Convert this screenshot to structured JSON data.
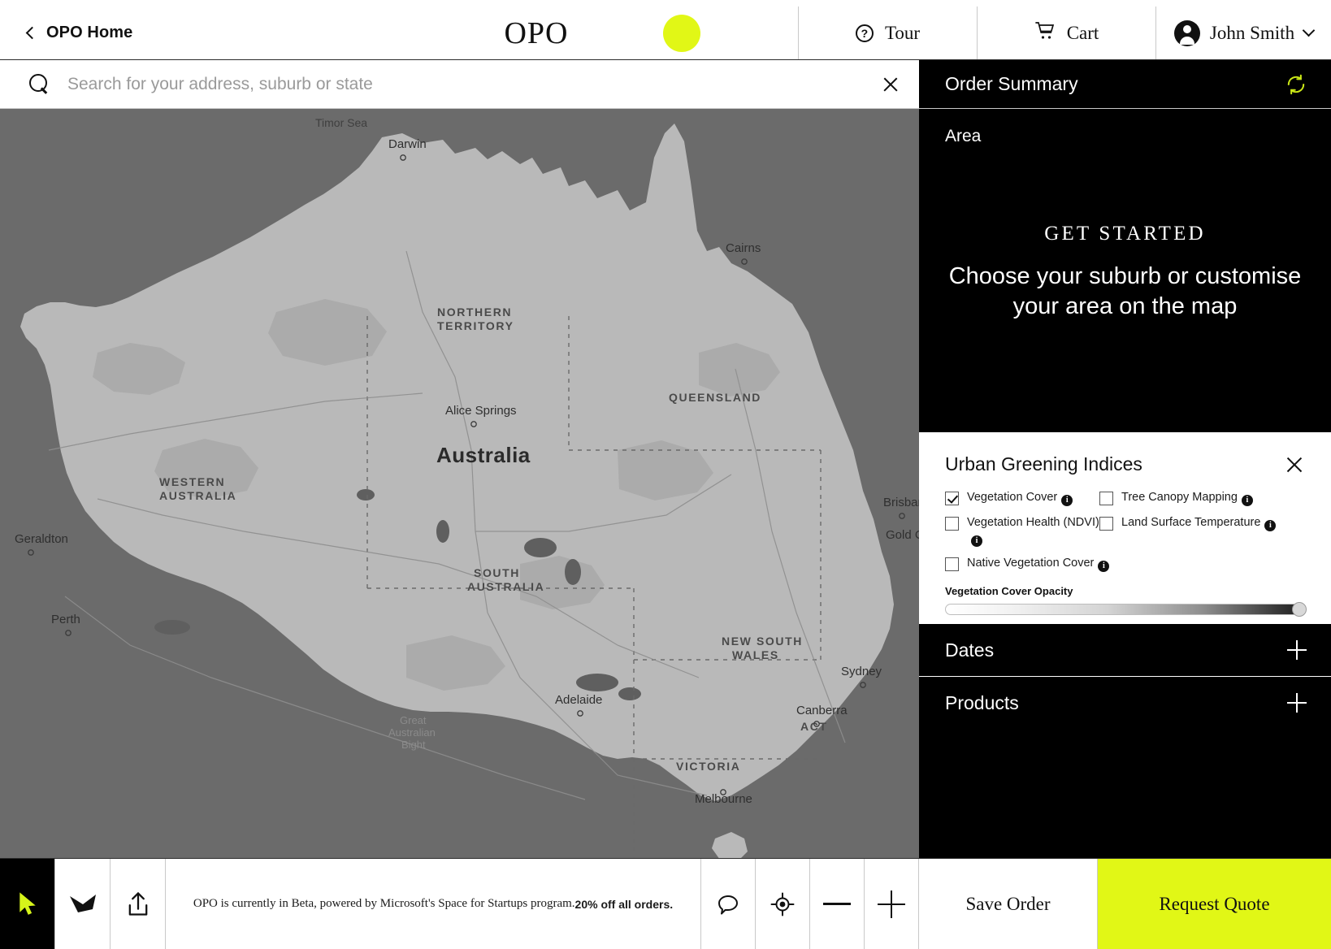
{
  "topbar": {
    "home_label": "OPO Home",
    "logo": "OPO",
    "tour_label": "Tour",
    "cart_label": "Cart",
    "user_name": "John Smith",
    "accent_color": "#e1f716",
    "icons": {
      "back": "chevron-left-icon",
      "help": "question-circle-icon",
      "cart": "shopping-cart-icon",
      "avatar": "user-avatar-icon",
      "caret": "chevron-down-icon"
    }
  },
  "search": {
    "placeholder": "Search for your address, suburb or state",
    "value": "",
    "clear_label": "Clear search"
  },
  "map": {
    "country_label": "Australia",
    "sea_labels": [
      "Timor Sea"
    ],
    "bight_label": [
      "Great",
      "Australian",
      "Bight"
    ],
    "states": [
      {
        "name": "NORTHERN\nTERRITORY",
        "line1": "NORTHERN",
        "line2": "TERRITORY"
      },
      {
        "name": "QUEENSLAND",
        "line1": "QUEENSLAND",
        "line2": ""
      },
      {
        "name": "WESTERN\nAUSTRALIA",
        "line1": "WESTERN",
        "line2": "AUSTRALIA"
      },
      {
        "name": "SOUTH\nAUSTRALIA",
        "line1": "SOUTH",
        "line2": "AUSTRALIA"
      },
      {
        "name": "NEW SOUTH\nWALES",
        "line1": "NEW SOUTH",
        "line2": "WALES"
      },
      {
        "name": "VICTORIA",
        "line1": "VICTORIA",
        "line2": ""
      },
      {
        "name": "ACT",
        "line1": "ACT",
        "line2": ""
      }
    ],
    "cities": [
      "Darwin",
      "Cairns",
      "Alice Springs",
      "Geraldton",
      "Perth",
      "Brisbane",
      "Gold Coast",
      "Adelaide",
      "Sydney",
      "Canberra",
      "Melbourne"
    ]
  },
  "rail": {
    "title": "Order Summary",
    "refresh_icon": "refresh-icon",
    "area_label": "Area",
    "get_started": {
      "kicker": "GET STARTED",
      "headline": "Choose your suburb or customise your area on the map"
    },
    "indices": {
      "title": "Urban Greening Indices",
      "close_label": "Close",
      "items": [
        {
          "label": "Vegetation Cover",
          "checked": true,
          "info": "i"
        },
        {
          "label": "Tree Canopy Mapping",
          "checked": false,
          "info": "i"
        },
        {
          "label": "Vegetation Health (NDVI)",
          "checked": false,
          "info": "i"
        },
        {
          "label": "Land Surface Temperature",
          "checked": false,
          "info": "i"
        },
        {
          "label": "Native Vegetation Cover",
          "checked": false,
          "info": "i"
        }
      ],
      "opacity_label": "Vegetation Cover Opacity",
      "opacity_value": 100
    },
    "sections": [
      {
        "label": "Dates",
        "expanded": false,
        "toggle": "+"
      },
      {
        "label": "Products",
        "expanded": false,
        "toggle": "+"
      }
    ]
  },
  "bottombar": {
    "tools": [
      {
        "name": "select-tool",
        "icon": "cursor-arrow-icon",
        "active": true
      },
      {
        "name": "polygon-tool",
        "icon": "polygon-icon",
        "active": false
      },
      {
        "name": "upload-tool",
        "icon": "upload-icon",
        "active": false
      }
    ],
    "banner_text": "OPO is currently in Beta, powered by Microsoft's Space for Startups program. ",
    "banner_bold": "20% off all orders.",
    "controls": [
      {
        "name": "feedback-button",
        "icon": "speech-bubble-icon"
      },
      {
        "name": "locate-button",
        "icon": "crosshair-icon"
      },
      {
        "name": "zoom-out-button",
        "icon": "minus-icon"
      },
      {
        "name": "zoom-in-button",
        "icon": "plus-icon"
      }
    ],
    "save_label": "Save Order",
    "quote_label": "Request Quote"
  }
}
